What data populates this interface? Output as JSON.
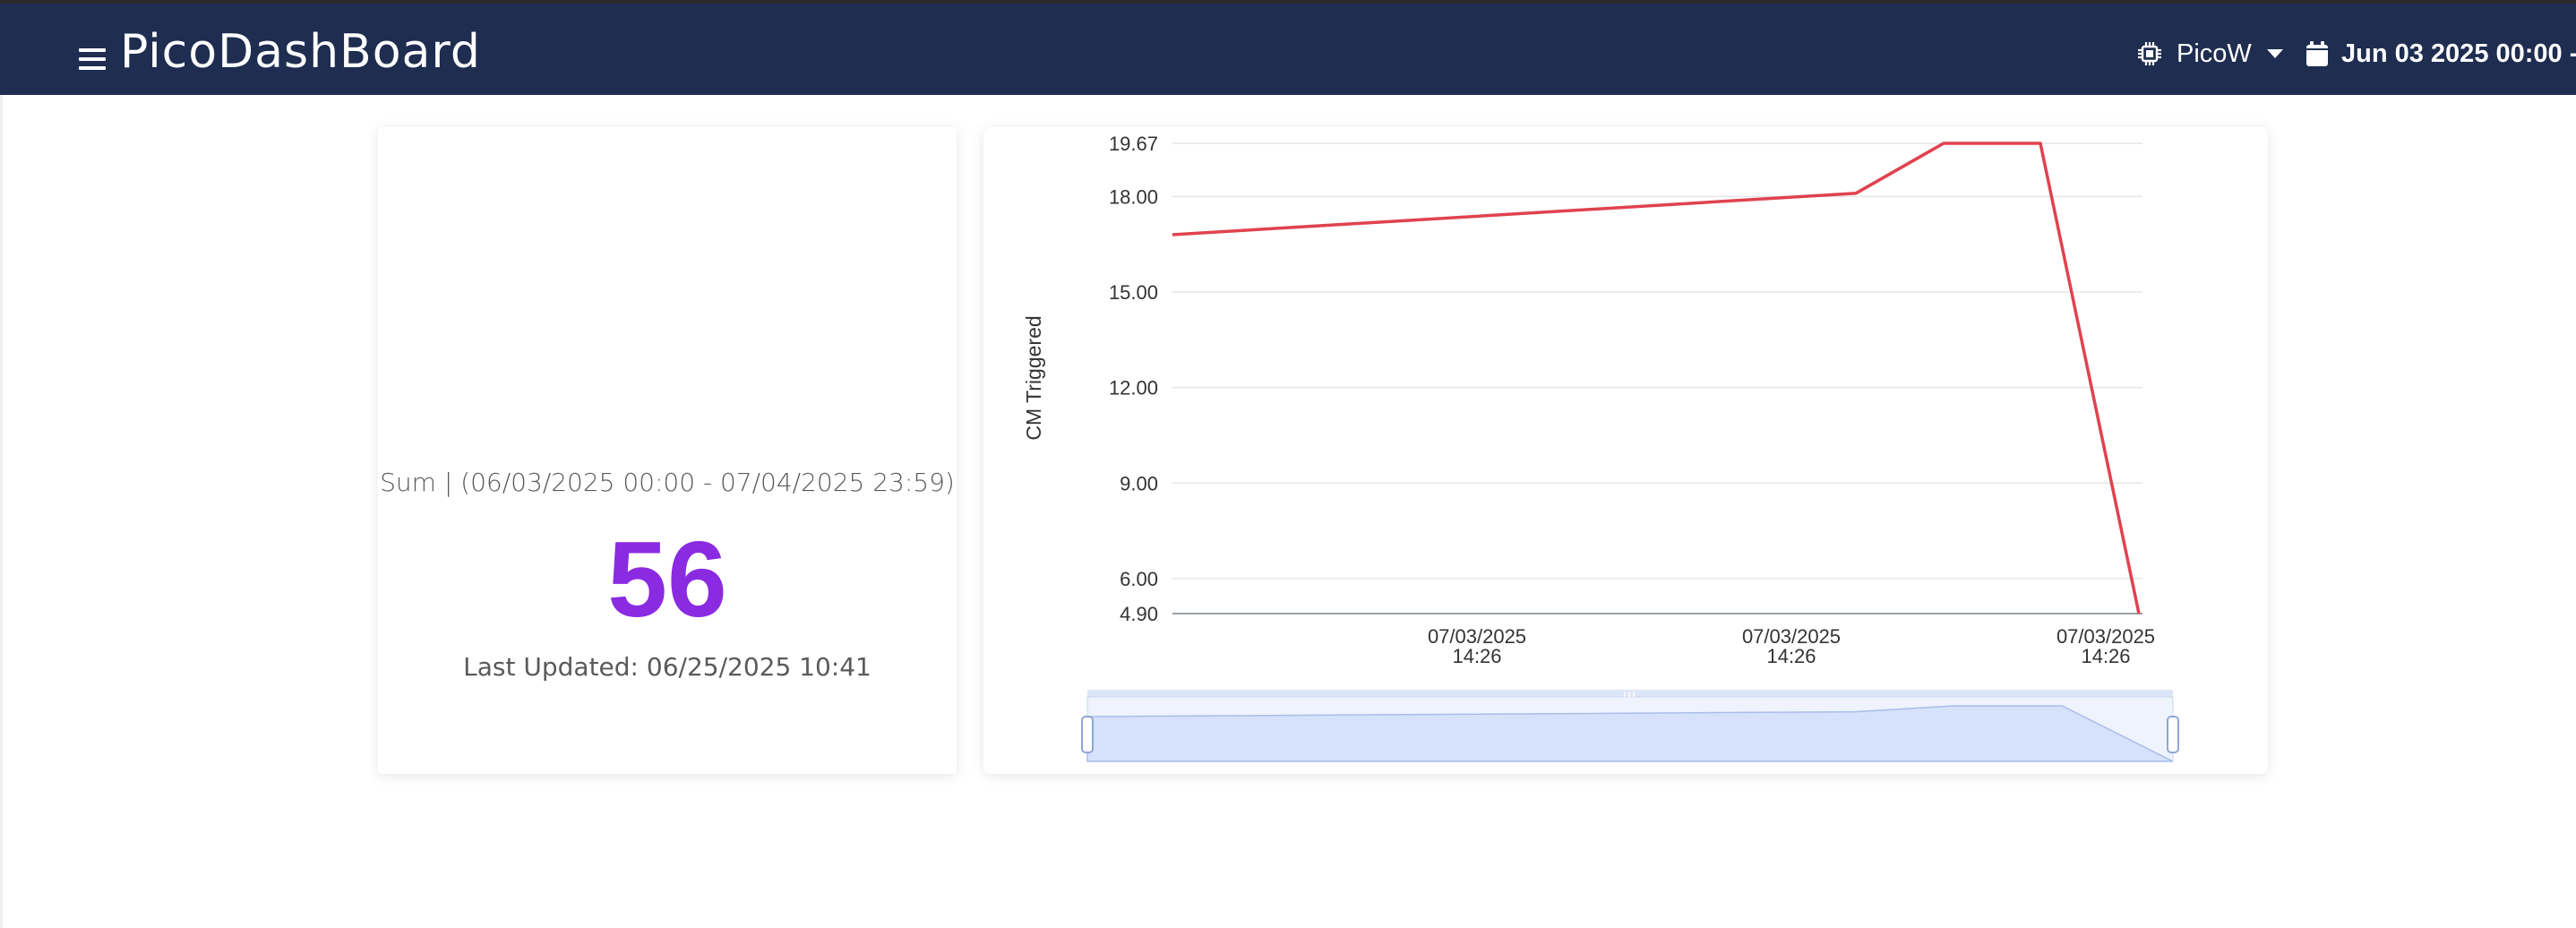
{
  "app": {
    "brand": "PicoDashBoard"
  },
  "navbar": {
    "device_label": "PicoW",
    "device_icon": "cpu-chip-icon",
    "date_range_label": "Jun 03 2025 00:00 - ",
    "date_icon": "calendar-icon",
    "menu_icon": "hamburger-menu-icon"
  },
  "colors": {
    "navbar_bg": "#1e2d50",
    "stat_value": "#8a2be2",
    "series_line": "#e0424f",
    "zoom_fill": "#d6e2fb"
  },
  "stat_card": {
    "title": "Sum | (06/03/2025 00:00 - 07/04/2025 23:59)",
    "value": "56",
    "last_updated": "Last Updated: 06/25/2025 10:41"
  },
  "chart_data": {
    "type": "line",
    "title": "",
    "xlabel": "",
    "ylabel": "CM Triggered",
    "ylim": [
      4.9,
      19.67
    ],
    "y_ticks": [
      "19.67",
      "18.00",
      "15.00",
      "12.00",
      "9.00",
      "6.00",
      "4.90"
    ],
    "x_tick_labels": [
      [
        "07/03/2025",
        "14:26"
      ],
      [
        "07/03/2025",
        "14:26"
      ],
      [
        "07/03/2025",
        "14:26"
      ]
    ],
    "grid": true,
    "series": [
      {
        "values": [
          16.8,
          18.1,
          19.67,
          19.67,
          4.9
        ]
      }
    ],
    "zoom_slider": true
  }
}
